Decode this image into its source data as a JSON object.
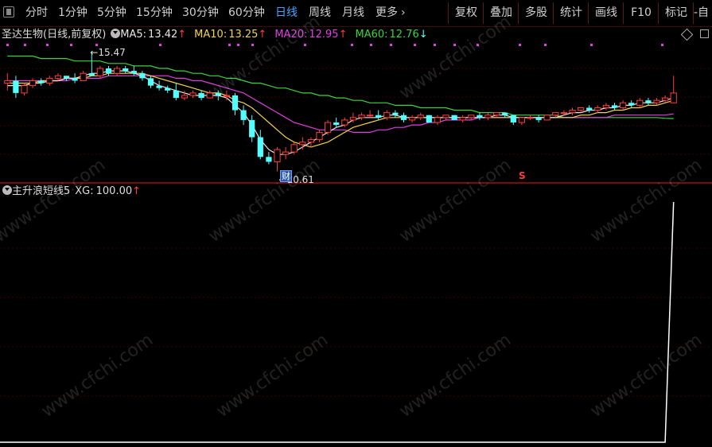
{
  "toolbar": {
    "tabs": [
      "分时",
      "1分钟",
      "5分钟",
      "15分钟",
      "30分钟",
      "60分钟",
      "日线",
      "周线",
      "月线",
      "更多"
    ],
    "active_tab": "日线",
    "more_arrow": "›",
    "right_buttons": [
      "复权",
      "叠加",
      "多股",
      "统计",
      "画线",
      "F10",
      "标记",
      "-自"
    ]
  },
  "main_chart": {
    "stock_name": "圣达生物(日线,前复权)",
    "ma5": {
      "label": "MA5:",
      "value": "13.42",
      "arrow": "↑",
      "color": "#e6e6e6"
    },
    "ma10": {
      "label": "MA10:",
      "value": "13.25",
      "arrow": "↑",
      "color": "#f2d349"
    },
    "ma20": {
      "label": "MA20:",
      "value": "12.95",
      "arrow": "↑",
      "color": "#e040e0"
    },
    "ma60": {
      "label": "MA60:",
      "value": "12.76",
      "arrow": "↓",
      "color": "#3cd43c"
    },
    "high_label": "15.47",
    "low_label": "10.61",
    "cai_badge": "财",
    "s_marker": "S"
  },
  "indicator": {
    "name": "主升浪短线5",
    "xg_label": "XG:",
    "xg_value": "100.00",
    "xg_arrow": "↑"
  },
  "watermark_text": "www.cfchi.com",
  "colors": {
    "up": "#ff3c3c",
    "down": "#54ffff",
    "divider": "#a01010",
    "grid": "#3a0000"
  },
  "chart_data": {
    "type": "candlestick",
    "candles": [
      [
        14.2,
        14.6,
        13.9,
        14.3
      ],
      [
        14.3,
        14.5,
        13.6,
        13.8
      ],
      [
        13.8,
        14.2,
        13.7,
        14.1
      ],
      [
        14.1,
        14.4,
        14.0,
        14.3
      ],
      [
        14.3,
        14.4,
        14.1,
        14.2
      ],
      [
        14.2,
        14.5,
        14.1,
        14.4
      ],
      [
        14.4,
        14.6,
        14.3,
        14.5
      ],
      [
        14.5,
        14.5,
        14.3,
        14.4
      ],
      [
        14.4,
        14.6,
        14.2,
        14.3
      ],
      [
        14.3,
        14.7,
        14.3,
        14.6
      ],
      [
        14.6,
        15.47,
        14.5,
        14.5
      ],
      [
        14.5,
        14.9,
        14.4,
        14.8
      ],
      [
        14.8,
        14.9,
        14.5,
        14.6
      ],
      [
        14.6,
        14.9,
        14.5,
        14.8
      ],
      [
        14.8,
        14.9,
        14.6,
        14.7
      ],
      [
        14.7,
        14.9,
        14.5,
        14.6
      ],
      [
        14.6,
        14.7,
        14.3,
        14.4
      ],
      [
        14.4,
        14.5,
        14.0,
        14.1
      ],
      [
        14.1,
        14.3,
        13.9,
        14.0
      ],
      [
        14.0,
        14.1,
        13.8,
        13.9
      ],
      [
        13.9,
        14.2,
        13.5,
        13.6
      ],
      [
        13.6,
        13.9,
        13.5,
        13.7
      ],
      [
        13.7,
        13.9,
        13.6,
        13.8
      ],
      [
        13.8,
        13.9,
        13.5,
        13.6
      ],
      [
        13.6,
        13.9,
        13.6,
        13.8
      ],
      [
        13.8,
        13.9,
        13.5,
        13.7
      ],
      [
        13.7,
        13.9,
        13.5,
        13.7
      ],
      [
        13.7,
        13.8,
        12.9,
        13.1
      ],
      [
        13.1,
        13.3,
        12.5,
        12.7
      ],
      [
        12.7,
        12.9,
        11.8,
        12.0
      ],
      [
        12.0,
        12.3,
        11.1,
        11.2
      ],
      [
        11.2,
        11.4,
        10.9,
        11.0
      ],
      [
        11.0,
        11.6,
        10.61,
        11.5
      ],
      [
        11.3,
        11.6,
        11.1,
        11.4
      ],
      [
        11.4,
        11.8,
        11.3,
        11.7
      ],
      [
        11.7,
        12.0,
        11.5,
        11.8
      ],
      [
        11.8,
        12.0,
        11.6,
        11.9
      ],
      [
        11.9,
        12.3,
        11.8,
        12.2
      ],
      [
        12.2,
        12.7,
        12.1,
        12.6
      ],
      [
        12.6,
        12.8,
        12.4,
        12.5
      ],
      [
        12.5,
        12.8,
        12.4,
        12.7
      ],
      [
        12.7,
        13.0,
        12.6,
        12.8
      ],
      [
        12.8,
        13.0,
        12.7,
        12.9
      ],
      [
        12.9,
        13.1,
        12.8,
        12.9
      ],
      [
        12.9,
        13.1,
        12.7,
        12.8
      ],
      [
        12.8,
        13.1,
        12.7,
        13.0
      ],
      [
        13.0,
        13.1,
        12.8,
        12.9
      ],
      [
        12.9,
        13.0,
        12.6,
        12.7
      ],
      [
        12.7,
        12.9,
        12.6,
        12.8
      ],
      [
        12.8,
        13.0,
        12.7,
        12.9
      ],
      [
        12.9,
        12.9,
        12.6,
        12.6
      ],
      [
        12.6,
        12.9,
        12.5,
        12.8
      ],
      [
        12.8,
        12.9,
        12.7,
        12.9
      ],
      [
        12.9,
        12.9,
        12.7,
        12.7
      ],
      [
        12.7,
        12.9,
        12.6,
        12.8
      ],
      [
        12.8,
        12.9,
        12.7,
        12.9
      ],
      [
        12.9,
        13.0,
        12.7,
        12.8
      ],
      [
        12.8,
        13.0,
        12.7,
        12.9
      ],
      [
        12.9,
        13.0,
        12.8,
        13.0
      ],
      [
        13.0,
        13.0,
        12.8,
        12.9
      ],
      [
        12.9,
        12.9,
        12.5,
        12.6
      ],
      [
        12.6,
        12.8,
        12.5,
        12.8
      ],
      [
        12.8,
        12.9,
        12.7,
        12.8
      ],
      [
        12.8,
        12.9,
        12.6,
        12.7
      ],
      [
        12.7,
        12.9,
        12.7,
        12.9
      ],
      [
        12.9,
        13.0,
        12.8,
        13.0
      ],
      [
        13.0,
        13.1,
        12.9,
        13.0
      ],
      [
        13.0,
        13.2,
        12.9,
        13.1
      ],
      [
        13.1,
        13.2,
        13.0,
        13.2
      ],
      [
        13.2,
        13.3,
        13.0,
        13.1
      ],
      [
        13.1,
        13.3,
        13.0,
        13.2
      ],
      [
        13.2,
        13.4,
        13.1,
        13.3
      ],
      [
        13.3,
        13.4,
        13.1,
        13.2
      ],
      [
        13.2,
        13.5,
        13.1,
        13.4
      ],
      [
        13.4,
        13.5,
        13.2,
        13.3
      ],
      [
        13.3,
        13.6,
        13.2,
        13.5
      ],
      [
        13.5,
        13.6,
        13.3,
        13.4
      ],
      [
        13.4,
        13.6,
        13.3,
        13.5
      ],
      [
        13.5,
        13.7,
        13.4,
        13.6
      ],
      [
        13.4,
        14.5,
        13.4,
        13.8
      ]
    ],
    "ma5": [
      14.1,
      14.1,
      14.1,
      14.2,
      14.2,
      14.3,
      14.3,
      14.4,
      14.4,
      14.5,
      14.6,
      14.6,
      14.7,
      14.7,
      14.7,
      14.6,
      14.5,
      14.3,
      14.1,
      14.0,
      13.9,
      13.8,
      13.7,
      13.7,
      13.7,
      13.7,
      13.6,
      13.3,
      13.0,
      12.5,
      11.9,
      11.5,
      11.3,
      11.3,
      11.4,
      11.6,
      11.8,
      12.0,
      12.2,
      12.4,
      12.5,
      12.7,
      12.8,
      12.8,
      12.8,
      12.9,
      12.9,
      12.8,
      12.8,
      12.8,
      12.8,
      12.8,
      12.8,
      12.8,
      12.8,
      12.8,
      12.8,
      12.8,
      12.9,
      12.9,
      12.8,
      12.8,
      12.8,
      12.8,
      12.8,
      12.8,
      12.9,
      13.0,
      13.0,
      13.1,
      13.1,
      13.2,
      13.2,
      13.3,
      13.3,
      13.4,
      13.4,
      13.4,
      13.5,
      13.6
    ],
    "ma10": [
      14.2,
      14.2,
      14.2,
      14.2,
      14.3,
      14.3,
      14.3,
      14.4,
      14.4,
      14.4,
      14.5,
      14.5,
      14.6,
      14.6,
      14.6,
      14.6,
      14.6,
      14.5,
      14.4,
      14.3,
      14.2,
      14.1,
      14.0,
      13.9,
      13.8,
      13.8,
      13.7,
      13.5,
      13.4,
      13.2,
      12.9,
      12.6,
      12.3,
      12.0,
      11.8,
      11.7,
      11.6,
      11.7,
      11.8,
      12.0,
      12.2,
      12.4,
      12.5,
      12.6,
      12.7,
      12.8,
      12.8,
      12.8,
      12.8,
      12.8,
      12.8,
      12.8,
      12.8,
      12.8,
      12.8,
      12.8,
      12.8,
      12.8,
      12.8,
      12.8,
      12.8,
      12.8,
      12.8,
      12.8,
      12.8,
      12.8,
      12.8,
      12.8,
      12.9,
      12.9,
      13.0,
      13.0,
      13.1,
      13.1,
      13.2,
      13.2,
      13.3,
      13.3,
      13.4,
      13.5
    ],
    "ma20": [
      14.3,
      14.3,
      14.3,
      14.3,
      14.3,
      14.3,
      14.3,
      14.3,
      14.4,
      14.4,
      14.4,
      14.4,
      14.5,
      14.5,
      14.5,
      14.5,
      14.5,
      14.5,
      14.5,
      14.5,
      14.4,
      14.4,
      14.3,
      14.3,
      14.2,
      14.1,
      14.0,
      13.9,
      13.8,
      13.6,
      13.4,
      13.2,
      13.0,
      12.8,
      12.6,
      12.5,
      12.4,
      12.3,
      12.3,
      12.3,
      12.3,
      12.2,
      12.2,
      12.2,
      12.3,
      12.3,
      12.4,
      12.4,
      12.5,
      12.5,
      12.6,
      12.6,
      12.7,
      12.7,
      12.7,
      12.7,
      12.8,
      12.8,
      12.8,
      12.8,
      12.8,
      12.8,
      12.8,
      12.8,
      12.8,
      12.8,
      12.8,
      12.8,
      12.8,
      12.8,
      12.8,
      12.8,
      12.9,
      12.9,
      12.9,
      12.9,
      12.9,
      12.9,
      12.9,
      12.95
    ],
    "ma60": [
      15.3,
      15.3,
      15.3,
      15.3,
      15.2,
      15.2,
      15.2,
      15.2,
      15.1,
      15.1,
      15.1,
      15.1,
      15.0,
      15.0,
      15.0,
      14.9,
      14.9,
      14.9,
      14.8,
      14.8,
      14.7,
      14.7,
      14.6,
      14.6,
      14.5,
      14.5,
      14.4,
      14.4,
      14.3,
      14.2,
      14.2,
      14.1,
      14.0,
      14.0,
      13.9,
      13.8,
      13.8,
      13.7,
      13.7,
      13.6,
      13.6,
      13.5,
      13.5,
      13.4,
      13.4,
      13.4,
      13.3,
      13.3,
      13.3,
      13.2,
      13.2,
      13.2,
      13.2,
      13.1,
      13.1,
      13.1,
      13.0,
      13.0,
      13.0,
      13.0,
      12.9,
      12.9,
      12.9,
      12.9,
      12.9,
      12.9,
      12.8,
      12.8,
      12.8,
      12.8,
      12.8,
      12.8,
      12.8,
      12.8,
      12.8,
      12.8,
      12.8,
      12.8,
      12.77,
      12.76
    ],
    "price_range": [
      10.4,
      15.9
    ],
    "indicator_xg": [
      0,
      0,
      0,
      0,
      0,
      0,
      0,
      0,
      0,
      0,
      0,
      0,
      0,
      0,
      0,
      0,
      0,
      0,
      0,
      0,
      0,
      0,
      0,
      0,
      0,
      0,
      0,
      0,
      0,
      0,
      0,
      0,
      0,
      0,
      0,
      0,
      0,
      0,
      0,
      0,
      0,
      0,
      0,
      0,
      0,
      0,
      0,
      0,
      0,
      0,
      0,
      0,
      0,
      0,
      0,
      0,
      0,
      0,
      0,
      0,
      0,
      0,
      0,
      0,
      0,
      0,
      0,
      0,
      0,
      0,
      0,
      0,
      0,
      0,
      0,
      0,
      0,
      0,
      0,
      100
    ],
    "indicator_range": [
      0,
      100
    ]
  }
}
